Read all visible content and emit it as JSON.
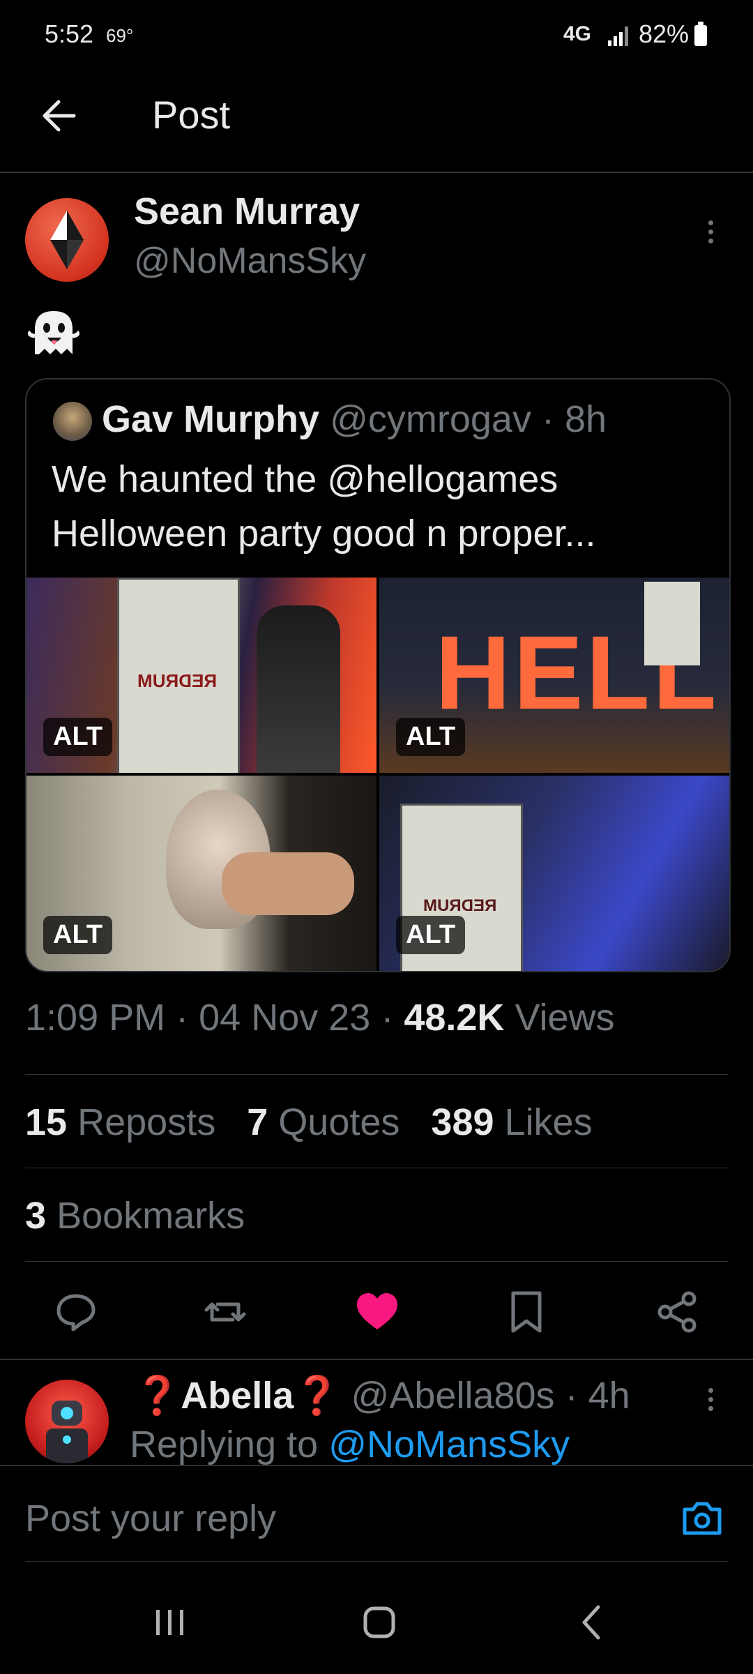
{
  "status": {
    "time": "5:52",
    "temp": "69°",
    "network": "4G",
    "battery": "82%"
  },
  "header": {
    "title": "Post"
  },
  "post": {
    "author_name": "Sean Murray",
    "author_handle": "@NoMansSky",
    "emoji": "👻",
    "quote": {
      "name": "Gav Murphy",
      "handle": "@cymrogav",
      "time": "8h",
      "text": "We haunted the @hellogames Helloween party good n proper...",
      "images": [
        {
          "badge": "ALT",
          "sign": "REDRUM"
        },
        {
          "badge": "ALT",
          "sign": "HELL"
        },
        {
          "badge": "ALT"
        },
        {
          "badge": "ALT",
          "sign": "REDRUM"
        }
      ]
    },
    "time": "1:09 PM",
    "date": "04 Nov 23",
    "views_count": "48.2K",
    "views_label": "Views",
    "reposts_count": "15",
    "reposts_label": "Reposts",
    "quotes_count": "7",
    "quotes_label": "Quotes",
    "likes_count": "389",
    "likes_label": "Likes",
    "bookmarks_count": "3",
    "bookmarks_label": "Bookmarks",
    "separator": "·"
  },
  "actions": {
    "reply_icon": "reply-icon",
    "repost_icon": "repost-icon",
    "like_icon": "heart-icon",
    "bookmark_icon": "bookmark-icon",
    "share_icon": "share-icon",
    "like_color": "#f91880"
  },
  "reply": {
    "name": "❓Abella❓",
    "handle": "@Abella80s",
    "time": "4h",
    "replying_to_label": "Replying to",
    "replying_to": "@NoMansSky"
  },
  "compose": {
    "placeholder": "Post your reply"
  },
  "colors": {
    "accent": "#1d9bf0",
    "like": "#f91880",
    "muted": "#71767b",
    "background": "#000000"
  }
}
